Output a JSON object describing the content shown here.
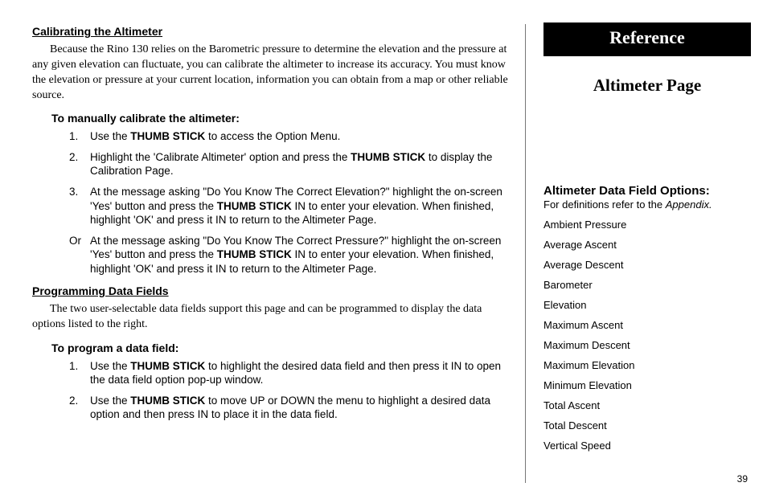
{
  "main": {
    "section1": {
      "heading": "Calibrating the Altimeter",
      "para": "Because the Rino 130 relies on the Barometric pressure to determine the elevation and the pressure at any given elevation can fluctuate, you can calibrate the altimeter to increase its accuracy. You must know the elevation or pressure at your current location, information you can obtain from a map or other reliable source.",
      "task_head": "To manually calibrate the altimeter:",
      "steps": [
        {
          "num": "1.",
          "pre": "Use the ",
          "bold": "THUMB STICK",
          "post": " to access the Option Menu."
        },
        {
          "num": "2.",
          "pre": "Highlight the 'Calibrate Altimeter' option and press the ",
          "bold": "THUMB STICK",
          "post": " to display the Calibration Page."
        },
        {
          "num": "3.",
          "pre": "At the message asking \"Do You Know The Correct Elevation?\" highlight the on-screen 'Yes' button and press the ",
          "bold": "THUMB STICK",
          "post": " IN to enter your elevation.  When finished, highlight 'OK' and press it IN to return to the Altimeter Page."
        },
        {
          "num": "Or",
          "pre": "At the message asking \"Do You Know The Correct Pressure?\" highlight the on-screen 'Yes' button and press the ",
          "bold": "THUMB STICK",
          "post": " IN to enter your elevation.  When finished, highlight 'OK' and press it IN to return to the Altimeter Page."
        }
      ]
    },
    "section2": {
      "heading": "Programming Data Fields",
      "para": "The two user-selectable data fields support this page and can be programmed to display the data options listed to the right.",
      "task_head": "To program a data field:",
      "steps": [
        {
          "num": "1.",
          "pre": "Use the ",
          "bold": "THUMB STICK",
          "post": " to highlight the desired data field and then press it IN to open the data field option pop-up window."
        },
        {
          "num": "2.",
          "pre": "Use the ",
          "bold": "THUMB STICK",
          "post": " to move UP or DOWN the menu to highlight a desired data option and then press IN to place it in the data field."
        }
      ]
    }
  },
  "side": {
    "banner": "Reference",
    "title": "Altimeter Page",
    "opt_head": "Altimeter Data Field Options:",
    "opt_sub_pre": "For definitions refer to the ",
    "opt_sub_it": "Appendix.",
    "options": [
      "Ambient Pressure",
      "Average Ascent",
      "Average Descent",
      "Barometer",
      "Elevation",
      "Maximum Ascent",
      "Maximum Descent",
      "Maximum Elevation",
      "Minimum Elevation",
      "Total Ascent",
      "Total Descent",
      "Vertical Speed"
    ]
  },
  "page_number": "39"
}
